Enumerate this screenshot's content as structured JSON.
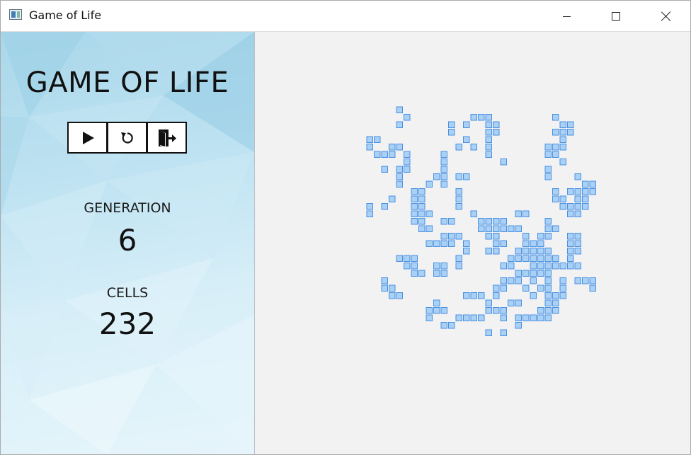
{
  "window": {
    "title": "Game of Life"
  },
  "sidebar": {
    "app_title": "GAME OF LIFE",
    "controls": [
      {
        "id": "play",
        "icon": "play-icon"
      },
      {
        "id": "reset",
        "icon": "reset-icon"
      },
      {
        "id": "exit",
        "icon": "exit-icon"
      }
    ],
    "generation": {
      "label": "GENERATION",
      "value": "6"
    },
    "cells": {
      "label": "CELLS",
      "value": "232"
    }
  },
  "colors": {
    "cell_fill": "#a9d0f5",
    "cell_border": "#4a90e2",
    "board_background": "#f2f2f2"
  },
  "board": {
    "rows": [
      {
        "row": 0,
        "cols": [
          4
        ]
      },
      {
        "row": 1,
        "cols": [
          5,
          14,
          15,
          16,
          25
        ]
      },
      {
        "row": 2,
        "cols": [
          4,
          11,
          13,
          16,
          17,
          26,
          27
        ]
      },
      {
        "row": 3,
        "cols": [
          11,
          16,
          17,
          25,
          26,
          27
        ]
      },
      {
        "row": 4,
        "cols": [
          0,
          1,
          13,
          16,
          26
        ]
      },
      {
        "row": 5,
        "cols": [
          0,
          3,
          4,
          12,
          14,
          16,
          24,
          25,
          26
        ]
      },
      {
        "row": 6,
        "cols": [
          1,
          2,
          3,
          5,
          10,
          16,
          24,
          25
        ]
      },
      {
        "row": 7,
        "cols": [
          5,
          10,
          18,
          26
        ]
      },
      {
        "row": 8,
        "cols": [
          2,
          4,
          5,
          10,
          24
        ]
      },
      {
        "row": 9,
        "cols": [
          4,
          9,
          10,
          12,
          13,
          24,
          28
        ]
      },
      {
        "row": 10,
        "cols": [
          4,
          8,
          10,
          29,
          30
        ]
      },
      {
        "row": 11,
        "cols": [
          6,
          7,
          12,
          25,
          27,
          28,
          29,
          30
        ]
      },
      {
        "row": 12,
        "cols": [
          3,
          6,
          7,
          12,
          25,
          26,
          28,
          29
        ]
      },
      {
        "row": 13,
        "cols": [
          0,
          2,
          6,
          7,
          12,
          26,
          27,
          28,
          29
        ]
      },
      {
        "row": 14,
        "cols": [
          0,
          6,
          7,
          8,
          14,
          20,
          21,
          27,
          28
        ]
      },
      {
        "row": 15,
        "cols": [
          6,
          7,
          10,
          11,
          15,
          16,
          17,
          18,
          24
        ]
      },
      {
        "row": 16,
        "cols": [
          7,
          8,
          15,
          16,
          17,
          18,
          19,
          20,
          24,
          25
        ]
      },
      {
        "row": 17,
        "cols": [
          10,
          11,
          12,
          16,
          17,
          21,
          23,
          24,
          27,
          28
        ]
      },
      {
        "row": 18,
        "cols": [
          8,
          9,
          10,
          11,
          13,
          17,
          18,
          21,
          22,
          23,
          27,
          28
        ]
      },
      {
        "row": 19,
        "cols": [
          13,
          16,
          17,
          20,
          21,
          22,
          23,
          24,
          27,
          28
        ]
      },
      {
        "row": 20,
        "cols": [
          4,
          5,
          6,
          12,
          19,
          20,
          21,
          22,
          23,
          24,
          25,
          27
        ]
      },
      {
        "row": 21,
        "cols": [
          5,
          6,
          9,
          10,
          12,
          18,
          19,
          22,
          23,
          24,
          25,
          26,
          27,
          28
        ]
      },
      {
        "row": 22,
        "cols": [
          6,
          7,
          9,
          10,
          20,
          21,
          22,
          23,
          24
        ]
      },
      {
        "row": 23,
        "cols": [
          2,
          18,
          19,
          20,
          22,
          24,
          26,
          28,
          29,
          30
        ]
      },
      {
        "row": 24,
        "cols": [
          2,
          3,
          17,
          18,
          21,
          23,
          24,
          26,
          30
        ]
      },
      {
        "row": 25,
        "cols": [
          3,
          4,
          13,
          14,
          15,
          17,
          22,
          24,
          25,
          26
        ]
      },
      {
        "row": 26,
        "cols": [
          9,
          16,
          19,
          20,
          24,
          25
        ]
      },
      {
        "row": 27,
        "cols": [
          8,
          9,
          10,
          16,
          17,
          18,
          23,
          24,
          25
        ]
      },
      {
        "row": 28,
        "cols": [
          8,
          12,
          13,
          14,
          15,
          18,
          20,
          21,
          22,
          23,
          24
        ]
      },
      {
        "row": 29,
        "cols": [
          10,
          11,
          20
        ]
      },
      {
        "row": 30,
        "cols": [
          16,
          18
        ]
      }
    ]
  }
}
